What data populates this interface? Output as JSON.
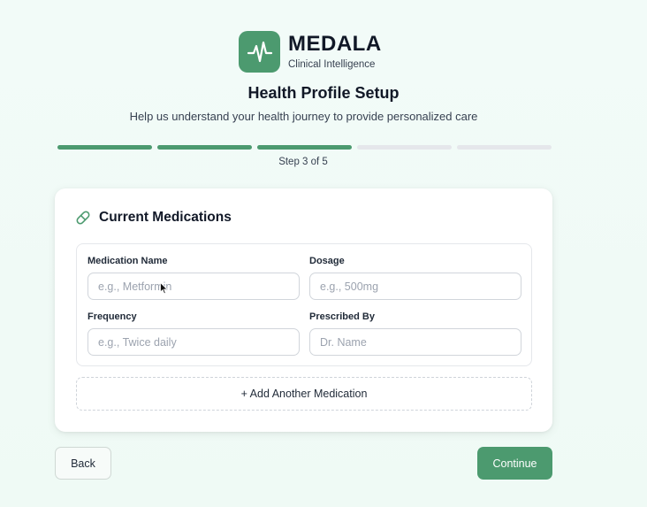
{
  "brand": {
    "name": "MEDALA",
    "tagline": "Clinical Intelligence",
    "logo_icon": "pulse-icon",
    "accent_color": "#4c9a6f"
  },
  "header": {
    "title": "Health Profile Setup",
    "subtitle": "Help us understand your health journey to provide personalized care"
  },
  "progress": {
    "current_step": 3,
    "total_steps": 5,
    "label": "Step 3 of 5"
  },
  "medications_card": {
    "icon": "pill-icon",
    "title": "Current Medications",
    "fields": {
      "name": {
        "label": "Medication Name",
        "placeholder": "e.g., Metformin",
        "value": ""
      },
      "dosage": {
        "label": "Dosage",
        "placeholder": "e.g., 500mg",
        "value": ""
      },
      "frequency": {
        "label": "Frequency",
        "placeholder": "e.g., Twice daily",
        "value": ""
      },
      "prescribed_by": {
        "label": "Prescribed By",
        "placeholder": "Dr. Name",
        "value": ""
      }
    },
    "add_label": "+ Add Another Medication"
  },
  "footer": {
    "back_label": "Back",
    "continue_label": "Continue"
  }
}
